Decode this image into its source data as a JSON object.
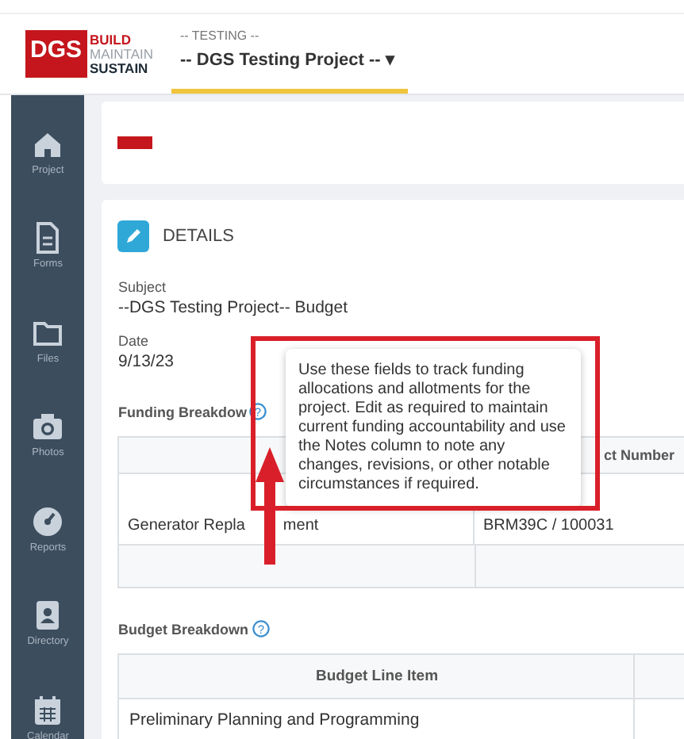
{
  "header": {
    "logo": {
      "mark": "DGS",
      "lines": [
        "BUILD",
        "MAINTAIN",
        "SUSTAIN"
      ]
    },
    "project_tab": {
      "subtitle": "-- TESTING --",
      "title": "-- DGS Testing Project --",
      "caret": "▾",
      "selected": true
    }
  },
  "sidebar": {
    "items": [
      {
        "kind": "home",
        "label": "Project"
      },
      {
        "kind": "document",
        "label": "Forms"
      },
      {
        "kind": "folder",
        "label": "Files"
      },
      {
        "kind": "camera",
        "label": "Photos"
      },
      {
        "kind": "gauge",
        "label": "Reports"
      },
      {
        "kind": "contact",
        "label": "Directory"
      },
      {
        "kind": "calendar",
        "label": "Calendar"
      }
    ]
  },
  "details": {
    "title": "DETAILS",
    "fields": [
      {
        "label": "Subject",
        "value": "--DGS Testing Project-- Budget"
      },
      {
        "label": "Date",
        "value": "9/13/23"
      }
    ],
    "funding_breakdown": {
      "heading": "Funding Breakdow",
      "help": "?",
      "columns": [
        null,
        "ct Number"
      ],
      "rows": [
        [
          [
            "Generator Repla",
            "ment"
          ],
          [
            "BRM39C / 100031"
          ]
        ],
        [
          [],
          []
        ]
      ]
    },
    "budget_breakdown": {
      "heading": "Budget Breakdown",
      "help": "?",
      "columns": [
        "Budget Line Item"
      ],
      "rows": [
        [
          [
            "Preliminary Planning and Programming"
          ]
        ]
      ]
    }
  },
  "tooltip": {
    "text": "Use these fields to track funding allocations and allotments for the project. Edit as required to maintain current funding accountability and use the Notes column to note any changes, revisions, or other notable circumstances if required."
  }
}
